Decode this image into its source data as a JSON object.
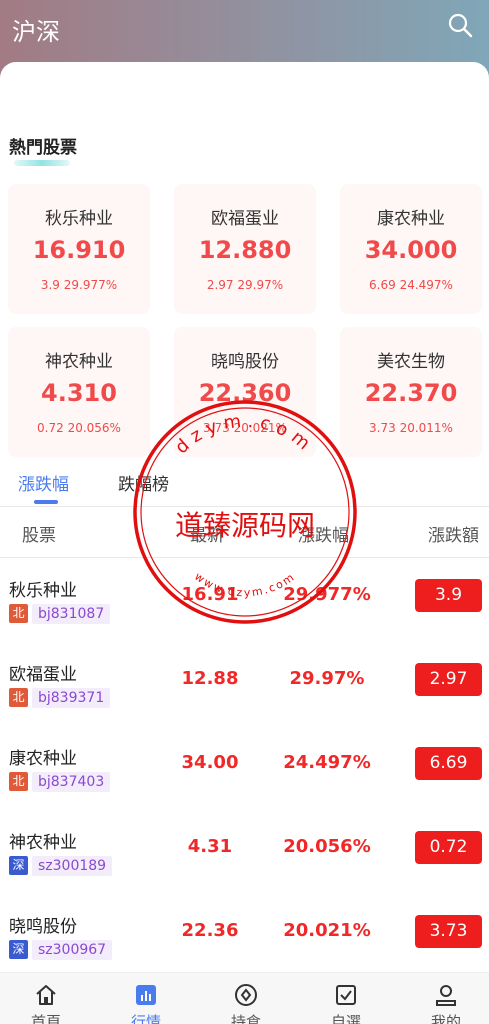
{
  "header": {
    "title": "沪深",
    "search_icon": "search-icon"
  },
  "hot": {
    "title": "熱門股票",
    "cards": [
      {
        "name": "秋乐种业",
        "price": "16.910",
        "change": "3.9 29.977%"
      },
      {
        "name": "欧福蛋业",
        "price": "12.880",
        "change": "2.97 29.97%"
      },
      {
        "name": "康农种业",
        "price": "34.000",
        "change": "6.69 24.497%"
      },
      {
        "name": "神农种业",
        "price": "4.310",
        "change": "0.72 20.056%"
      },
      {
        "name": "晓鸣股份",
        "price": "22.360",
        "change": "3.73 20.021%"
      },
      {
        "name": "美农生物",
        "price": "22.370",
        "change": "3.73 20.011%"
      }
    ]
  },
  "tabs": [
    {
      "label": "漲跌幅"
    },
    {
      "label": "跌幅榜"
    }
  ],
  "table": {
    "headers": [
      "股票",
      "最新",
      "漲跌幅",
      "漲跌額"
    ],
    "rows": [
      {
        "name": "秋乐种业",
        "market": "北",
        "code": "bj831087",
        "price": "16.91",
        "pct": "29.977%",
        "chg": "3.9"
      },
      {
        "name": "欧福蛋业",
        "market": "北",
        "code": "bj839371",
        "price": "12.88",
        "pct": "29.97%",
        "chg": "2.97"
      },
      {
        "name": "康农种业",
        "market": "北",
        "code": "bj837403",
        "price": "34.00",
        "pct": "24.497%",
        "chg": "6.69"
      },
      {
        "name": "神农种业",
        "market": "深",
        "code": "sz300189",
        "price": "4.31",
        "pct": "20.056%",
        "chg": "0.72"
      },
      {
        "name": "晓鸣股份",
        "market": "深",
        "code": "sz300967",
        "price": "22.36",
        "pct": "20.021%",
        "chg": "3.73"
      }
    ]
  },
  "tabbar": [
    {
      "label": "首頁",
      "icon": "home-icon"
    },
    {
      "label": "行情",
      "icon": "market-chart-icon"
    },
    {
      "label": "持倉",
      "icon": "position-icon"
    },
    {
      "label": "自選",
      "icon": "watchlist-icon"
    },
    {
      "label": "我的",
      "icon": "profile-icon"
    }
  ],
  "watermark": {
    "text": "道臻源码网",
    "url_top": "dzym.com",
    "url_bottom": "www.dzym.com"
  },
  "colors": {
    "accent": "#4a7cf0",
    "up": "#f02828",
    "beijing": "#e05a3a",
    "shenzhen": "#3a5bd0"
  }
}
